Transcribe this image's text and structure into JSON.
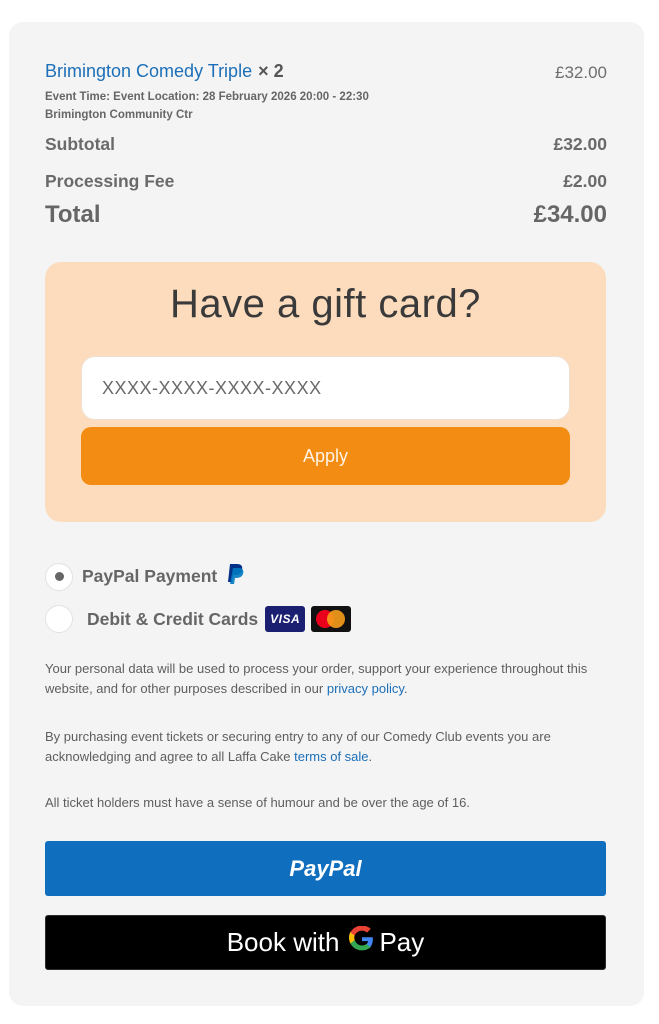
{
  "order": {
    "item_name": "Brimington Comedy Triple",
    "item_qty": "× 2",
    "item_price": "£32.00",
    "meta_line1": "Event Time:  Event Location:  28 February 2026 20:00 - 22:30",
    "meta_line2": "Brimington Community Ctr",
    "subtotal_label": "Subtotal",
    "subtotal_value": "£32.00",
    "fee_label": "Processing Fee",
    "fee_value": "£2.00",
    "total_label": "Total",
    "total_value": "£34.00"
  },
  "gift_card": {
    "title": "Have a gift card?",
    "placeholder": "XXXX-XXXX-XXXX-XXXX",
    "apply_label": "Apply"
  },
  "payment": {
    "paypal_label": "PayPal Payment",
    "cards_label": "Debit & Credit Cards",
    "visa_text": "VISA",
    "selected": "paypal"
  },
  "legal": {
    "p1_text": "Your personal data will be used to process your order, support your experience throughout this website, and for other purposes described in our ",
    "p1_link": "privacy policy",
    "p1_end": ".",
    "p2_text": "By purchasing event tickets or securing entry to any of our Comedy Club events you are acknowledging and agree to all Laffa Cake ",
    "p2_link": "terms of sale",
    "p2_end": ".",
    "p3_text": "All ticket holders must have a sense of humour and be over the age of 16."
  },
  "buttons": {
    "paypal_label": "PayPal",
    "gpay_prefix": "Book with",
    "gpay_suffix": "Pay"
  },
  "colors": {
    "link": "#1c6fb8",
    "apply": "#f28c12",
    "gift_bg": "#fcdcbc",
    "paypal_button": "#0f6fbe"
  }
}
